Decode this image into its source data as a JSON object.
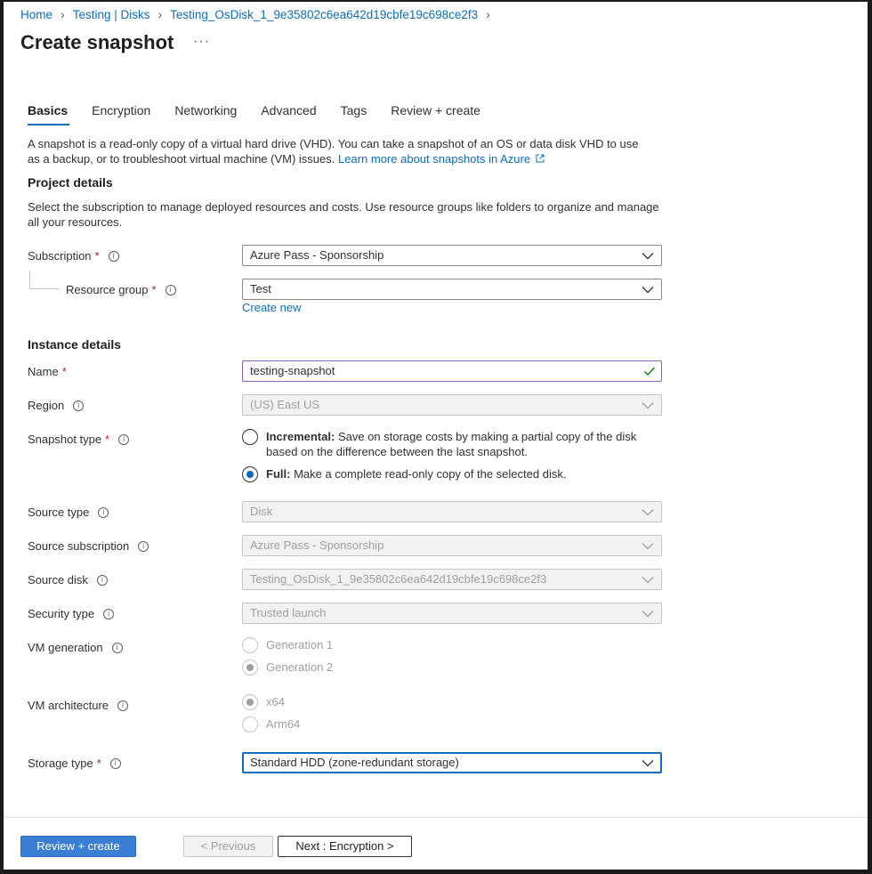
{
  "breadcrumb": {
    "items": [
      "Home",
      "Testing | Disks",
      "Testing_OsDisk_1_9e35802c6ea642d19cbfe19c698ce2f3"
    ]
  },
  "page": {
    "title": "Create snapshot",
    "more": "···"
  },
  "tabs": [
    "Basics",
    "Encryption",
    "Networking",
    "Advanced",
    "Tags",
    "Review + create"
  ],
  "intro": {
    "text": "A snapshot is a read-only copy of a virtual hard drive (VHD). You can take a snapshot of an OS or data disk VHD to use as a backup, or to troubleshoot virtual machine (VM) issues.",
    "link": "Learn more about snapshots in Azure"
  },
  "project": {
    "heading": "Project details",
    "description": "Select the subscription to manage deployed resources and costs. Use resource groups like folders to organize and manage all your resources.",
    "subscription_label": "Subscription",
    "subscription_value": "Azure Pass - Sponsorship",
    "resource_group_label": "Resource group",
    "resource_group_value": "Test",
    "create_new": "Create new"
  },
  "instance": {
    "heading": "Instance details",
    "name_label": "Name",
    "name_value": "testing-snapshot",
    "region_label": "Region",
    "region_value": "(US) East US",
    "snapshot_type_label": "Snapshot type",
    "incremental_title": "Incremental:",
    "incremental_desc": "Save on storage costs by making a partial copy of the disk based on the difference between the last snapshot.",
    "full_title": "Full:",
    "full_desc": "Make a complete read-only copy of the selected disk.",
    "source_type_label": "Source type",
    "source_type_value": "Disk",
    "source_subscription_label": "Source subscription",
    "source_subscription_value": "Azure Pass - Sponsorship",
    "source_disk_label": "Source disk",
    "source_disk_value": "Testing_OsDisk_1_9e35802c6ea642d19cbfe19c698ce2f3",
    "security_type_label": "Security type",
    "security_type_value": "Trusted launch",
    "vm_generation_label": "VM generation",
    "gen1": "Generation 1",
    "gen2": "Generation 2",
    "vm_architecture_label": "VM architecture",
    "x64": "x64",
    "arm64": "Arm64",
    "storage_type_label": "Storage type",
    "storage_type_value": "Standard HDD (zone-redundant storage)"
  },
  "footer": {
    "review_create": "Review + create",
    "previous": "< Previous",
    "next": "Next : Encryption >"
  },
  "colors": {
    "accent": "#0f6cbd",
    "required": "#a4262c",
    "valid_check": "#107c10",
    "primary_button": "#3b7fd4"
  }
}
